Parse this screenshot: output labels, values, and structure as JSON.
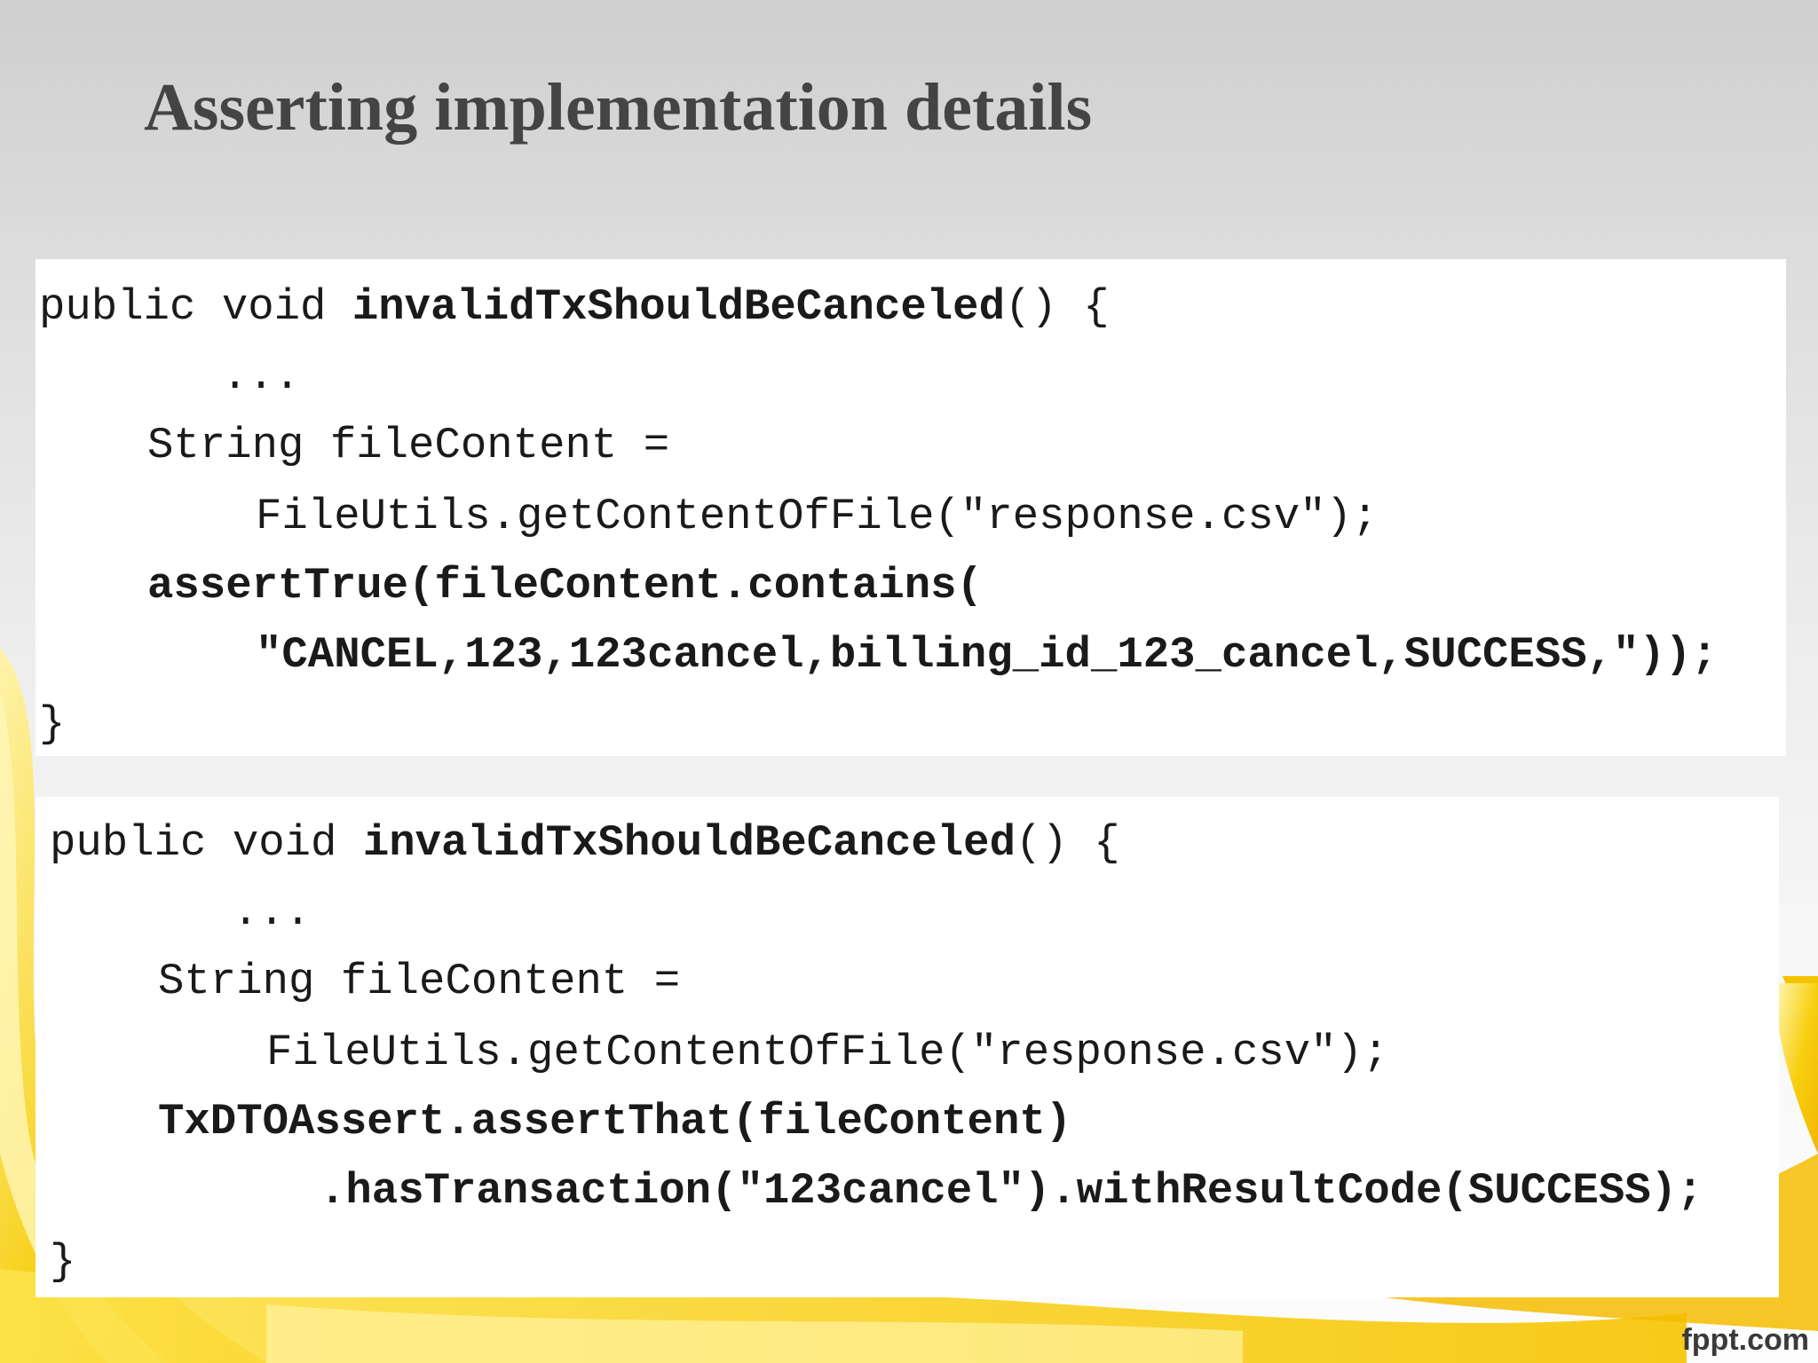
{
  "slide": {
    "title": "Asserting implementation details"
  },
  "block1": {
    "line1_prefix": "public void ",
    "line1_method": "invalidTxShouldBeCanceled",
    "line1_suffix": "() {",
    "line2": "...",
    "line3": "String fileContent =",
    "line4": "FileUtils.getContentOfFile(\"response.csv\");",
    "line5": "assertTrue(fileContent.contains(",
    "line6": "\"CANCEL,123,123cancel,billing_id_123_cancel,SUCCESS,\"));",
    "line7": "}"
  },
  "block2": {
    "line1_prefix": "public void ",
    "line1_method": "invalidTxShouldBeCanceled",
    "line1_suffix": "() {",
    "line2": "...",
    "line3": "String fileContent =",
    "line4": "FileUtils.getContentOfFile(\"response.csv\");",
    "line5": "TxDTOAssert.assertThat(fileContent)",
    "line6": ".hasTransaction(\"123cancel\").withResultCode(SUCCESS);",
    "line7": "}"
  },
  "footer": {
    "brand": "fppt.com"
  },
  "colors": {
    "accent_yellow": "#f5c800",
    "title_gray": "#444444"
  }
}
